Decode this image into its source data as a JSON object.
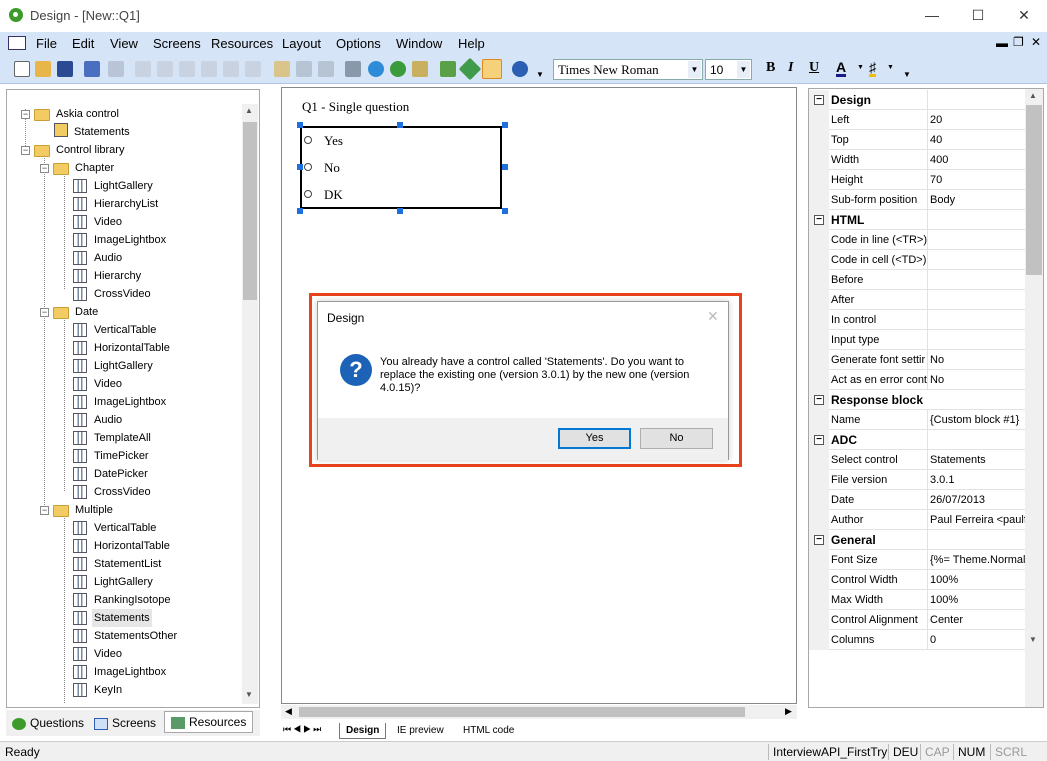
{
  "window": {
    "title": "Design - [New::Q1]"
  },
  "menu": [
    "File",
    "Edit",
    "View",
    "Screens",
    "Resources",
    "Layout",
    "Options",
    "Window",
    "Help"
  ],
  "toolbar": {
    "font": "Times New Roman",
    "size": "10",
    "bold": "B",
    "italic": "I",
    "underline": "U",
    "font_color": "A"
  },
  "tree": {
    "root": "Askia control",
    "root_child": "Statements",
    "library": "Control library",
    "chapter": {
      "label": "Chapter",
      "items": [
        "LightGallery",
        "HierarchyList",
        "Video",
        "ImageLightbox",
        "Audio",
        "Hierarchy",
        "CrossVideo"
      ]
    },
    "date": {
      "label": "Date",
      "items": [
        "VerticalTable",
        "HorizontalTable",
        "LightGallery",
        "Video",
        "ImageLightbox",
        "Audio",
        "TemplateAll",
        "TimePicker",
        "DatePicker",
        "CrossVideo"
      ]
    },
    "multiple": {
      "label": "Multiple",
      "items": [
        "VerticalTable",
        "HorizontalTable",
        "StatementList",
        "LightGallery",
        "RankingIsotope",
        "Statements",
        "StatementsOther",
        "Video",
        "ImageLightbox",
        "KeyIn"
      ]
    }
  },
  "left_tabs": [
    "Questions",
    "Screens",
    "Resources"
  ],
  "design": {
    "question_title": "Q1 - Single question",
    "options": [
      "Yes",
      "No",
      "DK"
    ]
  },
  "sheet_tabs": [
    "Design",
    "IE preview",
    "HTML code"
  ],
  "props": {
    "design": {
      "label": "Design",
      "rows": [
        [
          "Left",
          "20"
        ],
        [
          "Top",
          "40"
        ],
        [
          "Width",
          "400"
        ],
        [
          "Height",
          "70"
        ],
        [
          "Sub-form position",
          "Body"
        ]
      ]
    },
    "html": {
      "label": "HTML",
      "rows": [
        [
          "Code in line (<TR>)",
          ""
        ],
        [
          "Code in cell (<TD>)",
          ""
        ],
        [
          "Before",
          ""
        ],
        [
          "After",
          ""
        ],
        [
          "In control",
          ""
        ],
        [
          "Input type",
          ""
        ],
        [
          "Generate font settir",
          "No"
        ],
        [
          "Act as en error cont",
          "No"
        ]
      ]
    },
    "response": {
      "label": "Response block",
      "rows": [
        [
          "Name",
          "{Custom block #1}"
        ]
      ]
    },
    "adc": {
      "label": "ADC",
      "rows": [
        [
          "Select control",
          "Statements"
        ],
        [
          "File version",
          "3.0.1"
        ],
        [
          "Date",
          "26/07/2013"
        ],
        [
          "Author",
          "Paul Ferreira <paulf@"
        ]
      ]
    },
    "general": {
      "label": "General",
      "rows": [
        [
          "Font Size",
          "{%= Theme.NormalF"
        ],
        [
          "Control Width",
          "100%"
        ],
        [
          "Max Width",
          "100%"
        ],
        [
          "Control Alignment",
          "Center"
        ],
        [
          "Columns",
          "0"
        ]
      ]
    }
  },
  "dialog": {
    "title": "Design",
    "message": "You already have a control called 'Statements'. Do you want to replace the existing one (version 3.0.1) by the new one (version 4.0.15)?",
    "yes": "Yes",
    "no": "No"
  },
  "status": {
    "left": "Ready",
    "project": "InterviewAPI_FirstTry",
    "lang": "DEU",
    "cap": "CAP",
    "num": "NUM",
    "scrl": "SCRL"
  },
  "colors": {
    "menubar": "#d6e4f7",
    "highlight": "#e8431c",
    "accent": "#1c63b7"
  }
}
